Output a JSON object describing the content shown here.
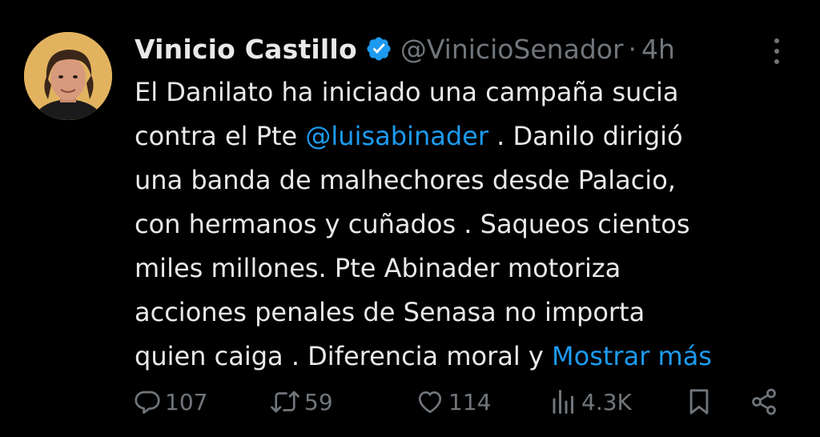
{
  "author": {
    "name": "Vinicio Castillo",
    "handle": "@VinicioSenador",
    "separator": "·",
    "time": "4h",
    "verified": true
  },
  "tweet": {
    "line1": "El Danilato ha iniciado una campaña sucia",
    "line2_before": "contra el Pte ",
    "mention": "@luisabinader",
    "line2_after": " . Danilo dirigió",
    "line3": "una banda de malhechores desde Palacio,",
    "line4": "con hermanos y cuñados . Saqueos cientos",
    "line5": "miles millones. Pte Abinader motoriza",
    "line6": "acciones penales de Senasa no importa",
    "line7_before": "quien caiga . Diferencia moral y ",
    "show_more": "Mostrar más"
  },
  "metrics": {
    "replies": "107",
    "reposts": "59",
    "likes": "114",
    "views": "4.3K"
  },
  "icons": {
    "reply": "reply-icon",
    "repost": "repost-icon",
    "like": "heart-icon",
    "views": "views-icon",
    "bookmark": "bookmark-icon",
    "share": "share-icon",
    "more": "more-vertical-icon",
    "verified": "verified-badge-icon"
  },
  "colors": {
    "background": "#000000",
    "text": "#e7e9ea",
    "muted": "#71767b",
    "link": "#1d9bf0"
  }
}
